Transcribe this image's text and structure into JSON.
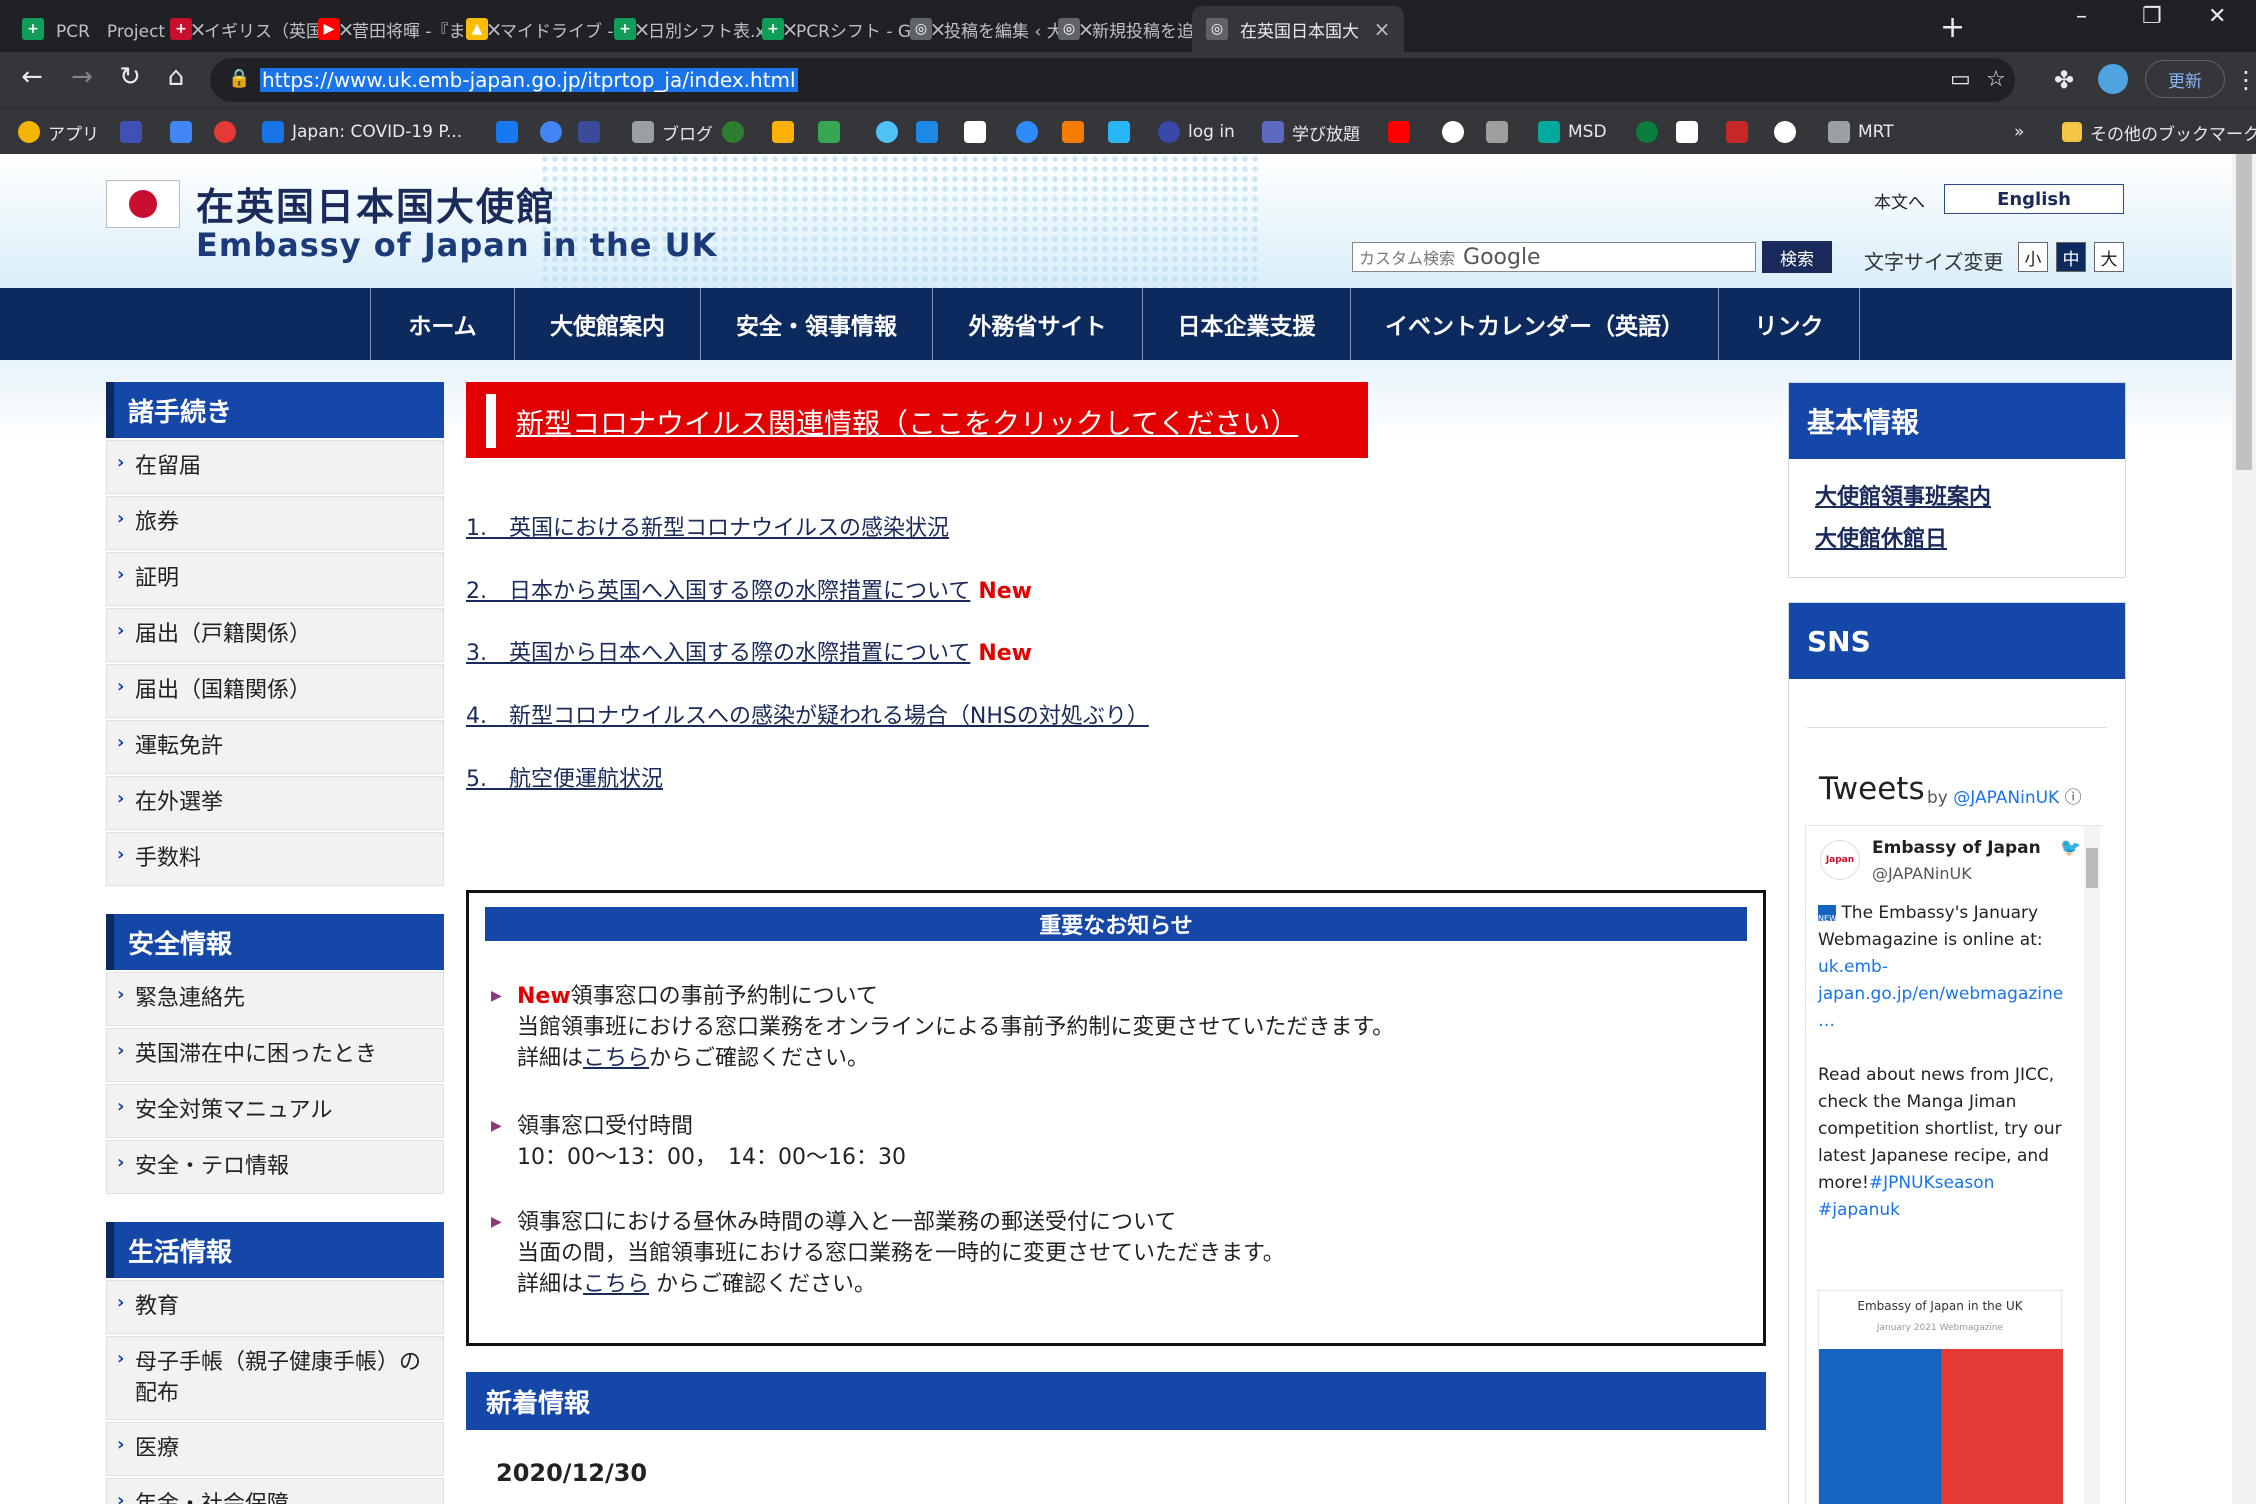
{
  "browser": {
    "tabs": [
      {
        "title": "PCR　Project",
        "color": "#0f9d58",
        "glyph": "+"
      },
      {
        "title": "イギリス（英国）",
        "color": "#c8102e",
        "glyph": "+"
      },
      {
        "title": "菅田将暉 -『ま",
        "color": "#ff0000",
        "glyph": "▶"
      },
      {
        "title": "マイドライブ - Go",
        "color": "#fbbc04",
        "glyph": "▲"
      },
      {
        "title": "日別シフト表.xls",
        "color": "#0f9d58",
        "glyph": "+"
      },
      {
        "title": "PCRシフト - Goo",
        "color": "#0f9d58",
        "glyph": "+"
      },
      {
        "title": "投稿を編集 ‹ 大",
        "color": "#5f6368",
        "glyph": "◎"
      },
      {
        "title": "新規投稿を追加",
        "color": "#5f6368",
        "glyph": "◎"
      },
      {
        "title": "在英国日本国大",
        "color": "#5f6368",
        "glyph": "◎"
      }
    ],
    "url": "https://www.uk.emb-japan.go.jp/itprtop_ja/index.html",
    "update_label": "更新",
    "bookmarks": [
      {
        "label": "アプリ",
        "color": "#f4b400"
      },
      {
        "label": "",
        "color": "#3f51b5"
      },
      {
        "label": "",
        "color": "#4285f4"
      },
      {
        "label": "",
        "color": "#e53935"
      },
      {
        "label": "Japan: COVID-19 P...",
        "color": "#1a73e8"
      },
      {
        "label": "",
        "color": "#1877f2"
      },
      {
        "label": "",
        "color": "#4285f4"
      },
      {
        "label": "",
        "color": "#3c4a9a"
      },
      {
        "label": "ブログ",
        "color": "#9aa0a6"
      },
      {
        "label": "",
        "color": "#2e7d32"
      },
      {
        "label": "",
        "color": "#ffb300"
      },
      {
        "label": "",
        "color": "#34a853"
      },
      {
        "label": "",
        "color": "#4fc3f7"
      },
      {
        "label": "",
        "color": "#1e88e5"
      },
      {
        "label": "",
        "color": "#ffffff"
      },
      {
        "label": "",
        "color": "#2d8cff"
      },
      {
        "label": "",
        "color": "#f57c00"
      },
      {
        "label": "",
        "color": "#29b6f6"
      },
      {
        "label": "log in",
        "color": "#3949ab"
      },
      {
        "label": "学び放題",
        "color": "#5c6bc0"
      },
      {
        "label": "",
        "color": "#ff0000"
      },
      {
        "label": "",
        "color": "#ffffff"
      },
      {
        "label": "",
        "color": "#9e9e9e"
      },
      {
        "label": "MSD",
        "color": "#00a99d"
      },
      {
        "label": "",
        "color": "#0a7d3e"
      },
      {
        "label": "",
        "color": "#ffffff"
      },
      {
        "label": "",
        "color": "#c62828"
      },
      {
        "label": "",
        "color": "#ffffff"
      },
      {
        "label": "MRT",
        "color": "#9aa0a6"
      }
    ],
    "more_bookmarks": "»",
    "other_bookmarks": "その他のブックマーク"
  },
  "header": {
    "title_jp": "在英国日本国大使館",
    "title_en": "Embassy of Japan in the UK",
    "honbun": "本文へ",
    "english": "English",
    "search_placeholder": "カスタム検索",
    "search_brand": "Google",
    "search_button": "検索",
    "font_size_label": "文字サイズ変更",
    "font_sizes": [
      "小",
      "中",
      "大"
    ]
  },
  "nav": [
    "ホーム",
    "大使館案内",
    "安全・領事情報",
    "外務省サイト",
    "日本企業支援",
    "イベントカレンダー（英語）",
    "リンク"
  ],
  "sidebar": {
    "sections": [
      {
        "heading": "諸手続き",
        "items": [
          "在留届",
          "旅券",
          "証明",
          "届出（戸籍関係）",
          "届出（国籍関係）",
          "運転免許",
          "在外選挙",
          "手数料"
        ]
      },
      {
        "heading": "安全情報",
        "items": [
          "緊急連絡先",
          "英国滞在中に困ったとき",
          "安全対策マニュアル",
          "安全・テロ情報"
        ]
      },
      {
        "heading": "生活情報",
        "items": [
          "教育",
          "母子手帳（親子健康手帳）の配布",
          "医療",
          "年金・社会保障"
        ]
      }
    ]
  },
  "main": {
    "covid_banner": "新型コロナウイルス関連情報（ここをクリックしてください）",
    "covid_links": [
      {
        "text": "1.　英国における新型コロナウイルスの感染状況",
        "badge": ""
      },
      {
        "text": "2.　日本から英国へ入国する際の水際措置について",
        "badge": "New"
      },
      {
        "text": "3.　英国から日本へ入国する際の水際措置について",
        "badge": "New"
      },
      {
        "text": "4.　新型コロナウイルスへの感染が疑われる場合（NHSの対処ぶり）",
        "badge": ""
      },
      {
        "text": "5.　航空便運航状況",
        "badge": ""
      }
    ],
    "notice": {
      "title": "重要なお知らせ",
      "item1_badge": "New",
      "item1_line1": "領事窓口の事前予約制について",
      "item1_line2": "当館領事班における窓口業務をオンラインによる事前予約制に変更させていただきます。",
      "item1_pre": "詳細は",
      "item1_link": "こちら",
      "item1_post": "からご確認ください。",
      "item2_line1": "領事窓口受付時間",
      "item2_line2": "10：00～13：00，　14：00～16：30",
      "item3_line1": "領事窓口における昼休み時間の導入と一部業務の郵送受付について",
      "item3_line2": "当面の間，当館領事班における窓口業務を一時的に変更させていただきます。",
      "item3_pre": "詳細は",
      "item3_link": "こちら",
      "item3_post": " からご確認ください。"
    },
    "news_heading": "新着情報",
    "news_date": "2020/12/30"
  },
  "right": {
    "basic_heading": "基本情報",
    "basic_links": [
      "大使館領事班案内",
      "大使館休館日"
    ],
    "sns_heading": "SNS",
    "tweets_title": "Tweets",
    "tweets_by": "by",
    "tweets_handle": "@JAPANinUK",
    "tweet_name": "Embassy of Japan",
    "tweet_handle": "@JAPANinUK",
    "tweet_text1": "The Embassy's January Webmagazine is online at:",
    "tweet_link": "uk.emb-japan.go.jp/en/webmagazine …",
    "tweet_text2": "Read about news from JICC, check the Manga Jiman competition shortlist, try our latest Japanese recipe, and more!",
    "tweet_tags": "#JPNUKseason #japanuk",
    "wm_title": "Embassy of Japan in the UK",
    "wm_sub": "January 2021 Webmagazine"
  }
}
